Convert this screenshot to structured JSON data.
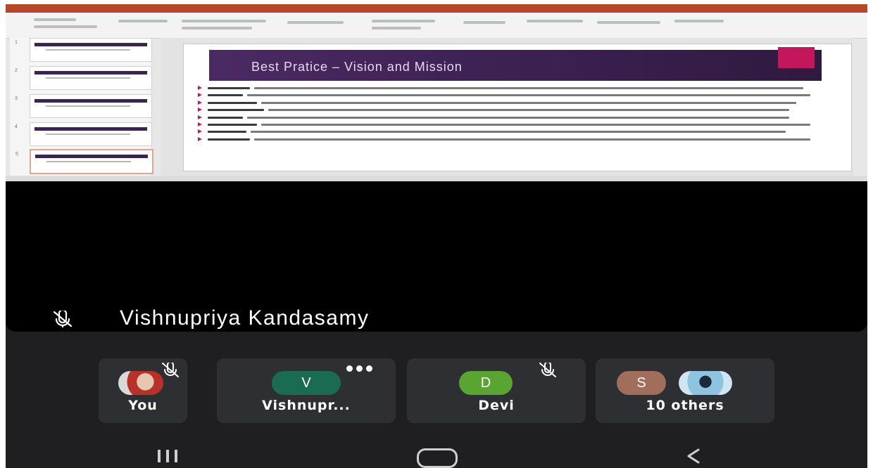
{
  "shared_screen": {
    "slide_title": "Best Pratice – Vision and Mission",
    "active_slide_index": 5,
    "thumbnail_numbers": [
      "1",
      "2",
      "3",
      "4",
      "5"
    ]
  },
  "speaker": {
    "name": "Vishnupriya Kandasamy",
    "mic_icon": "mic-off-icon"
  },
  "participants": [
    {
      "name": "You",
      "avatar_type": "photo",
      "muted": true
    },
    {
      "name": "Vishnupr...",
      "avatar_letter": "V",
      "avatar_color": "#1b6b52",
      "more_menu": true
    },
    {
      "name": "Devi",
      "avatar_letter": "D",
      "avatar_color": "#5aa532",
      "muted": true
    },
    {
      "name": "10 others",
      "avatar_letter": "S",
      "avatar_color": "#a06e5b"
    }
  ],
  "colors": {
    "background": "#1f1f21",
    "tile": "#2e2f33",
    "slide_header": "#3a1f4f",
    "slide_accent": "#c2185b"
  },
  "navigation": {
    "recent_icon": "recent-apps-icon",
    "home_icon": "home-icon",
    "back_icon": "back-icon"
  }
}
